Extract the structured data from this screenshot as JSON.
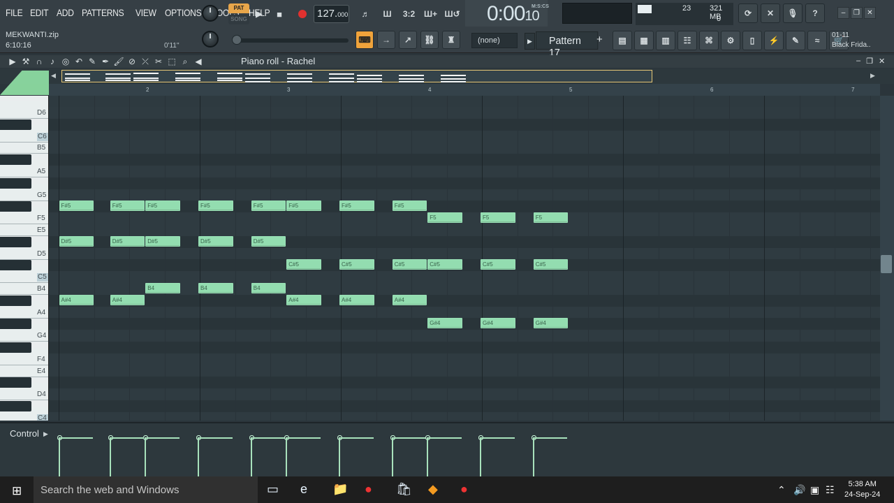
{
  "menu": {
    "items": [
      "FILE",
      "EDIT",
      "ADD",
      "PATTERNS",
      "VIEW",
      "OPTIONS",
      "TOOLS",
      "HELP"
    ]
  },
  "transport": {
    "pat_label": "PAT",
    "song_label": "SONG",
    "tempo_main": "127.",
    "tempo_fraction": "000",
    "time_display": "0:00",
    "time_small": "10",
    "time_label": "M:S:CS",
    "cpu_value": "23",
    "memory": "321 MB",
    "voices": "0"
  },
  "project": {
    "file_name": "MEKWANTI.zip",
    "elapsed": "6:10:16",
    "playhead_time": "0'11''"
  },
  "pattern": {
    "none_label": "(none)",
    "current_label": "Pattern 17",
    "add_label": "+"
  },
  "hint": {
    "line1": "01-11",
    "line2": "Black Frida.."
  },
  "piano_roll": {
    "title": "Piano roll - Rachel"
  },
  "ruler_numbers": [
    "2",
    "3",
    "4",
    "5",
    "6",
    "7"
  ],
  "keys": {
    "labels": [
      "D6",
      "C6",
      "B5",
      "A5",
      "G5",
      "F5",
      "E5",
      "D5",
      "C5",
      "B4",
      "A4",
      "G4",
      "F4",
      "E4",
      "D4",
      "C4"
    ]
  },
  "control": {
    "label": "Control"
  },
  "notes": [
    {
      "label": "F#5",
      "pitch": "F#5",
      "beat": 0.05,
      "len": 1
    },
    {
      "label": "F#5",
      "pitch": "F#5",
      "beat": 1.5,
      "len": 1
    },
    {
      "label": "F#5",
      "pitch": "F#5",
      "beat": 2.5,
      "len": 1
    },
    {
      "label": "F#5",
      "pitch": "F#5",
      "beat": 4,
      "len": 1
    },
    {
      "label": "F#5",
      "pitch": "F#5",
      "beat": 5.5,
      "len": 1
    },
    {
      "label": "F#5",
      "pitch": "F#5",
      "beat": 6.5,
      "len": 1
    },
    {
      "label": "F#5",
      "pitch": "F#5",
      "beat": 8,
      "len": 1
    },
    {
      "label": "F#5",
      "pitch": "F#5",
      "beat": 9.5,
      "len": 1
    },
    {
      "label": "F5",
      "pitch": "F5",
      "beat": 10.5,
      "len": 1
    },
    {
      "label": "F5",
      "pitch": "F5",
      "beat": 12,
      "len": 1
    },
    {
      "label": "F5",
      "pitch": "F5",
      "beat": 13.5,
      "len": 1
    },
    {
      "label": "D#5",
      "pitch": "D#5",
      "beat": 0.05,
      "len": 1
    },
    {
      "label": "D#5",
      "pitch": "D#5",
      "beat": 1.5,
      "len": 1
    },
    {
      "label": "D#5",
      "pitch": "D#5",
      "beat": 2.5,
      "len": 1
    },
    {
      "label": "D#5",
      "pitch": "D#5",
      "beat": 4,
      "len": 1
    },
    {
      "label": "D#5",
      "pitch": "D#5",
      "beat": 5.5,
      "len": 1
    },
    {
      "label": "C#5",
      "pitch": "C#5",
      "beat": 6.5,
      "len": 1
    },
    {
      "label": "C#5",
      "pitch": "C#5",
      "beat": 8,
      "len": 1
    },
    {
      "label": "C#5",
      "pitch": "C#5",
      "beat": 9.5,
      "len": 1
    },
    {
      "label": "C#5",
      "pitch": "C#5",
      "beat": 10.5,
      "len": 1
    },
    {
      "label": "C#5",
      "pitch": "C#5",
      "beat": 12,
      "len": 1
    },
    {
      "label": "C#5",
      "pitch": "C#5",
      "beat": 13.5,
      "len": 1
    },
    {
      "label": "B4",
      "pitch": "B4",
      "beat": 2.5,
      "len": 1
    },
    {
      "label": "B4",
      "pitch": "B4",
      "beat": 4,
      "len": 1
    },
    {
      "label": "B4",
      "pitch": "B4",
      "beat": 5.5,
      "len": 1
    },
    {
      "label": "A#4",
      "pitch": "A#4",
      "beat": 0.05,
      "len": 1
    },
    {
      "label": "A#4",
      "pitch": "A#4",
      "beat": 1.5,
      "len": 1
    },
    {
      "label": "A#4",
      "pitch": "A#4",
      "beat": 6.5,
      "len": 1
    },
    {
      "label": "A#4",
      "pitch": "A#4",
      "beat": 8,
      "len": 1
    },
    {
      "label": "A#4",
      "pitch": "A#4",
      "beat": 9.5,
      "len": 1
    },
    {
      "label": "G#4",
      "pitch": "G#4",
      "beat": 10.5,
      "len": 1
    },
    {
      "label": "G#4",
      "pitch": "G#4",
      "beat": 12,
      "len": 1
    },
    {
      "label": "G#4",
      "pitch": "G#4",
      "beat": 13.5,
      "len": 1
    }
  ],
  "taskbar": {
    "search_placeholder": "Search the web and Windows",
    "time": "5:38 AM",
    "date": "24-Sep-24"
  }
}
